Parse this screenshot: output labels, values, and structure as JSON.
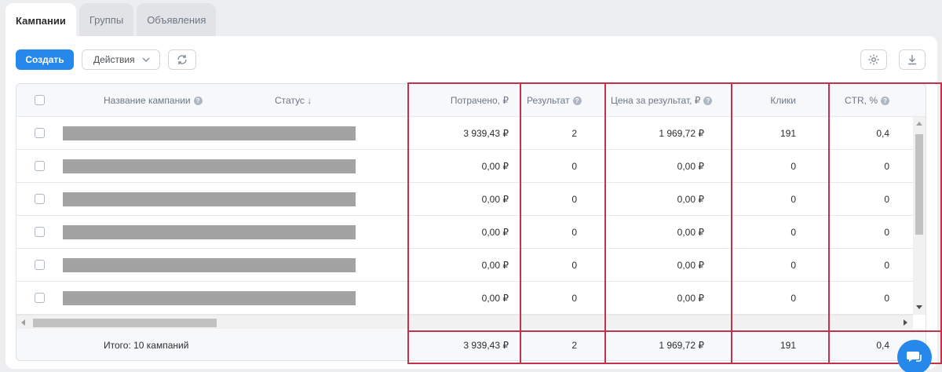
{
  "tabs": [
    {
      "label": "Кампании",
      "active": true
    },
    {
      "label": "Группы",
      "active": false
    },
    {
      "label": "Объявления",
      "active": false
    }
  ],
  "toolbar": {
    "create_label": "Создать",
    "actions_label": "Действия",
    "refresh_icon": "refresh-icon",
    "settings_icon": "gear-icon",
    "download_icon": "download-icon"
  },
  "table": {
    "columns": {
      "name": "Название кампании",
      "status": "Статус ↓",
      "spent": "Потрачено, ₽",
      "result": "Результат",
      "cpr": "Цена за результат, ₽",
      "clicks": "Клики",
      "ctr": "CTR, %"
    },
    "rows": [
      {
        "spent": "3 939,43 ₽",
        "result": "2",
        "cpr": "1 969,72 ₽",
        "clicks": "191",
        "ctr": "0,4"
      },
      {
        "spent": "0,00 ₽",
        "result": "0",
        "cpr": "0,00 ₽",
        "clicks": "0",
        "ctr": "0"
      },
      {
        "spent": "0,00 ₽",
        "result": "0",
        "cpr": "0,00 ₽",
        "clicks": "0",
        "ctr": "0"
      },
      {
        "spent": "0,00 ₽",
        "result": "0",
        "cpr": "0,00 ₽",
        "clicks": "0",
        "ctr": "0"
      },
      {
        "spent": "0,00 ₽",
        "result": "0",
        "cpr": "0,00 ₽",
        "clicks": "0",
        "ctr": "0"
      },
      {
        "spent": "0,00 ₽",
        "result": "0",
        "cpr": "0,00 ₽",
        "clicks": "0",
        "ctr": "0"
      }
    ],
    "total": {
      "label": "Итого: 10 кампаний",
      "spent": "3 939,43 ₽",
      "result": "2",
      "cpr": "1 969,72 ₽",
      "clicks": "191",
      "ctr": "0,4"
    }
  },
  "colors": {
    "accent": "#2688eb",
    "highlight": "#c0334d",
    "redacted": "#a3a3a3"
  }
}
